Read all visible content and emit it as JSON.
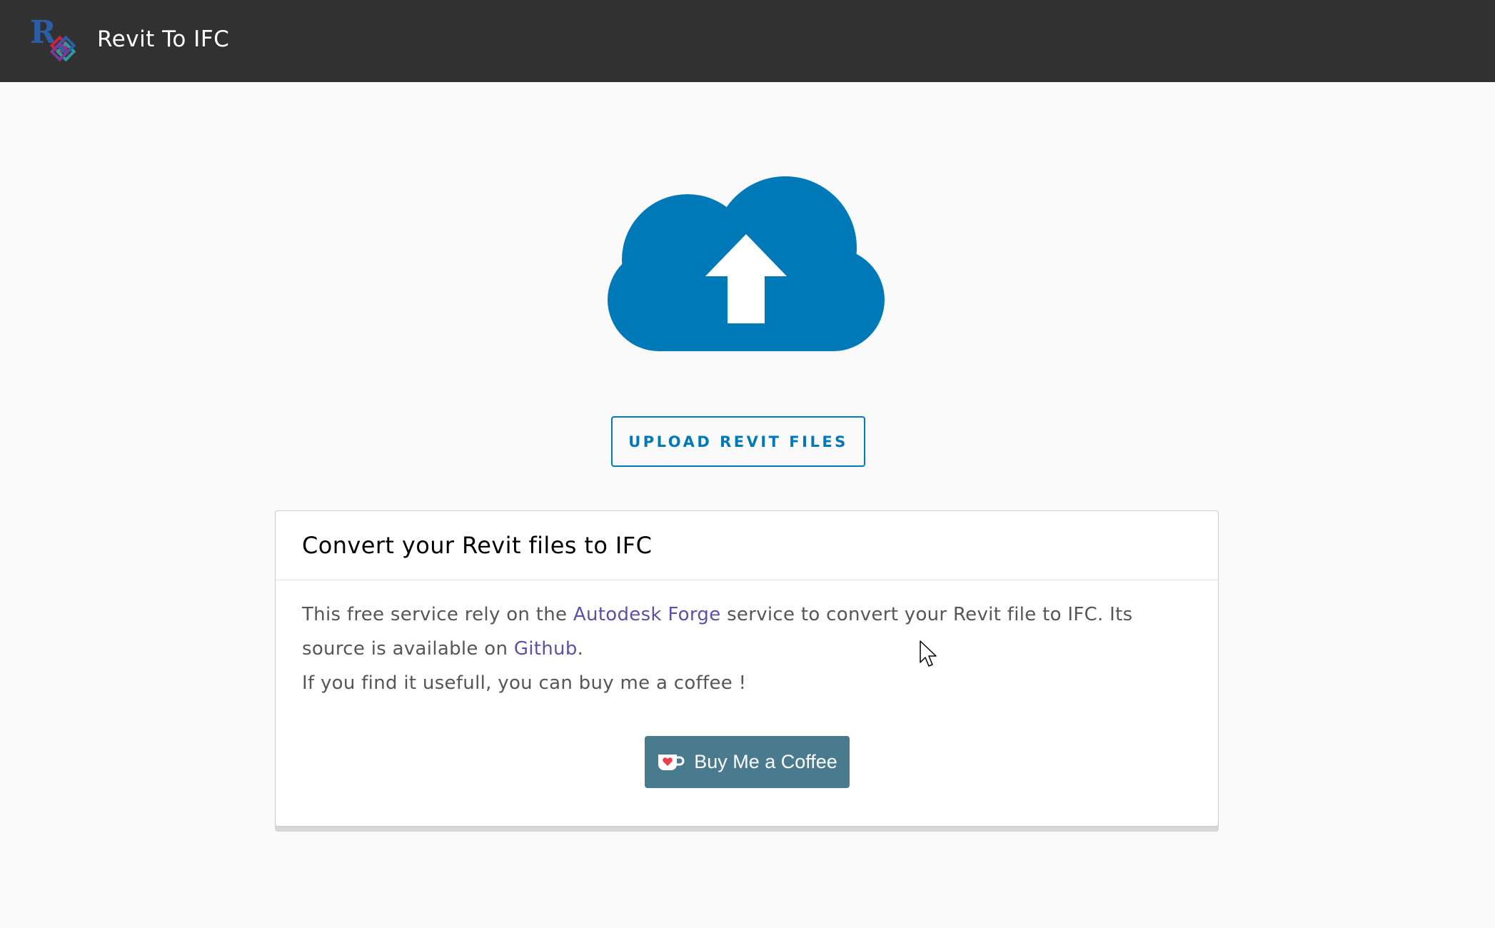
{
  "header": {
    "logo_letter": "R",
    "title": "Revit To IFC"
  },
  "upload": {
    "icon": "cloud-upload-icon",
    "button_label": "UPLOAD REVIT FILES"
  },
  "card": {
    "title": "Convert your Revit files to IFC",
    "line1_pre": "This free service rely on the ",
    "link_forge": "Autodesk Forge",
    "line1_post": " service to convert your Revit file to IFC. Its",
    "line2_pre": "source is available on ",
    "link_github": "Github",
    "line2_post": ".",
    "line3": "If you find it usefull, you can buy me a coffee !",
    "coffee_button": "Buy Me a Coffee",
    "coffee_icon": "coffee-cup-heart-icon"
  },
  "colors": {
    "topbar": "#313131",
    "accent": "#0079b8",
    "link": "#5a52a8",
    "coffee_button": "#4a7a8e"
  }
}
